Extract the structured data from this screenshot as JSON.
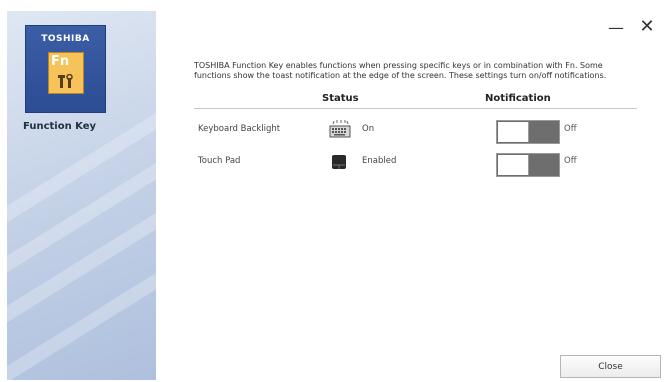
{
  "sidebar": {
    "brand": "TOSHIBA",
    "logo_key_text": "Fn",
    "app_title": "Function Key"
  },
  "titlebar": {
    "minimize_glyph": "—",
    "close_glyph": "✕"
  },
  "main": {
    "description": "TOSHIBA Function Key enables functions when pressing specific keys or in combination with Fn. Some functions show the toast notification at the edge of the screen. These settings turn on/off notifications.",
    "headers": {
      "status": "Status",
      "notification": "Notification"
    },
    "rows": [
      {
        "label": "Keyboard Backlight",
        "icon": "keyboard-backlight-icon",
        "status": "On",
        "notification": "Off"
      },
      {
        "label": "Touch Pad",
        "icon": "touchpad-icon",
        "status": "Enabled",
        "notification": "Off"
      }
    ]
  },
  "footer": {
    "close_label": "Close"
  }
}
